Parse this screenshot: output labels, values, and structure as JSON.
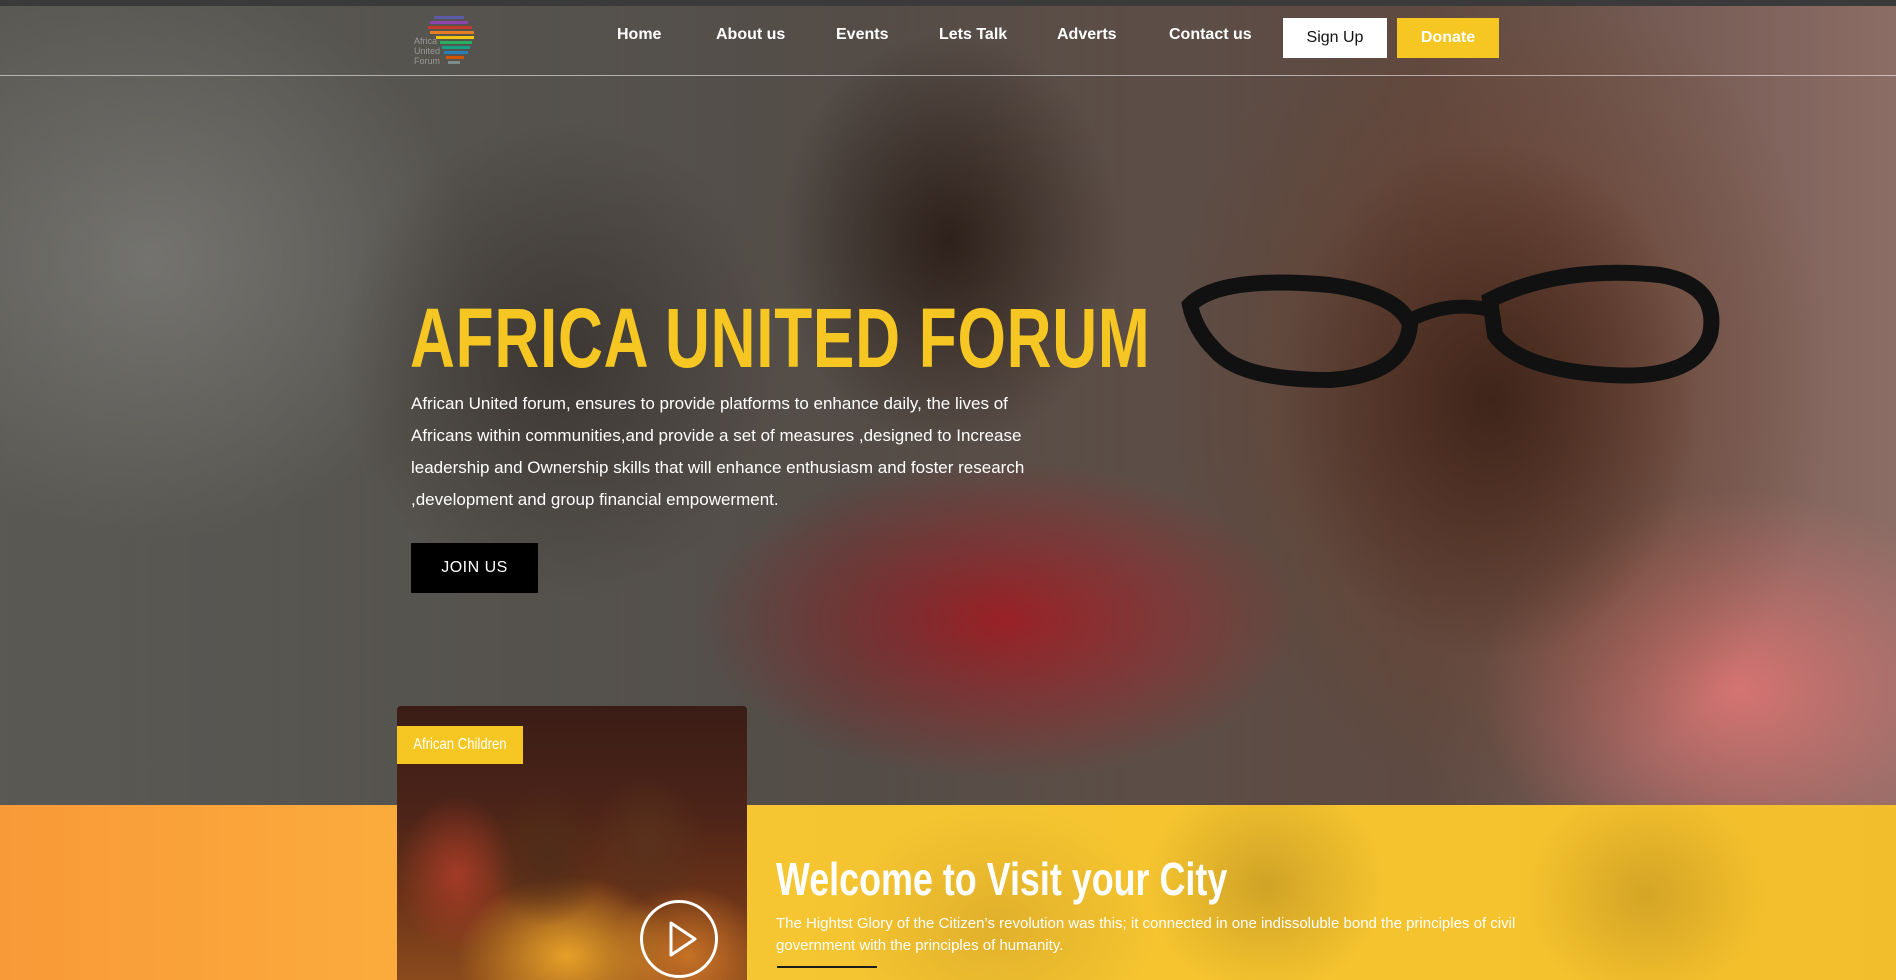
{
  "nav": {
    "logo_text": "Africa\nUnited\nForum",
    "links": [
      "Home",
      "About us",
      "Events",
      "Lets Talk",
      "Adverts",
      "Contact us"
    ],
    "signup_label": "Sign Up",
    "donate_label": "Donate"
  },
  "hero": {
    "title": "AFRICA UNITED FORUM",
    "description": "African United forum, ensures to provide platforms to enhance daily, the lives of Africans within communities,and provide a set of measures ,designed to Increase leadership and Ownership skills that will enhance enthusiasm and foster research ,development and group financial empowerment.",
    "join_label": "JOIN US"
  },
  "video_card": {
    "tag": "African Children",
    "play_icon": "play-icon"
  },
  "welcome": {
    "title": "Welcome to Visit your City",
    "description": "The Hightst Glory of the Citizen’s revolution was this; it connected in one indissoluble bond the principles of civil government with the principles of humanity."
  },
  "colors": {
    "accent": "#f6c722",
    "orange": "#f99a38",
    "dark": "#000000"
  }
}
